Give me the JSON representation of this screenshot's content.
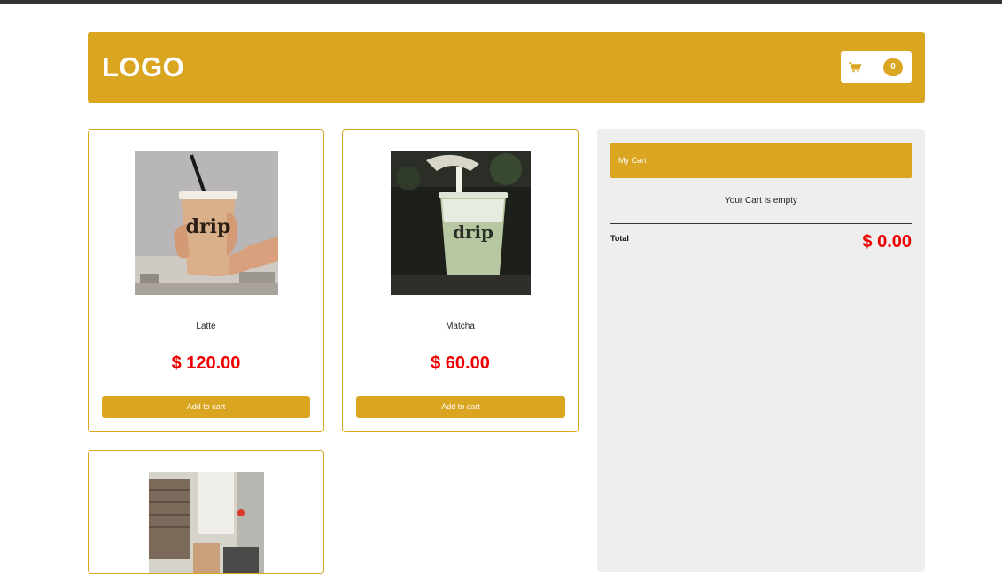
{
  "header": {
    "logo": "LOGO",
    "cart_count": "0",
    "cart_icon": "shopping-cart-icon"
  },
  "products": [
    {
      "name": "Latte",
      "price": "$ 120.00",
      "button_label": "Add to cart",
      "cup_label": "drip"
    },
    {
      "name": "Matcha",
      "price": "$ 60.00",
      "button_label": "Add to cart",
      "cup_label": "drip"
    },
    {
      "name": "",
      "price": "",
      "button_label": ""
    }
  ],
  "cart": {
    "title": "My Cart",
    "empty_message": "Your Cart is empty",
    "total_label": "Total",
    "total_value": "$ 0.00"
  },
  "colors": {
    "accent": "#DAA520",
    "price": "#EE0000",
    "panel": "#EEEEEE",
    "topbar": "#333333"
  }
}
